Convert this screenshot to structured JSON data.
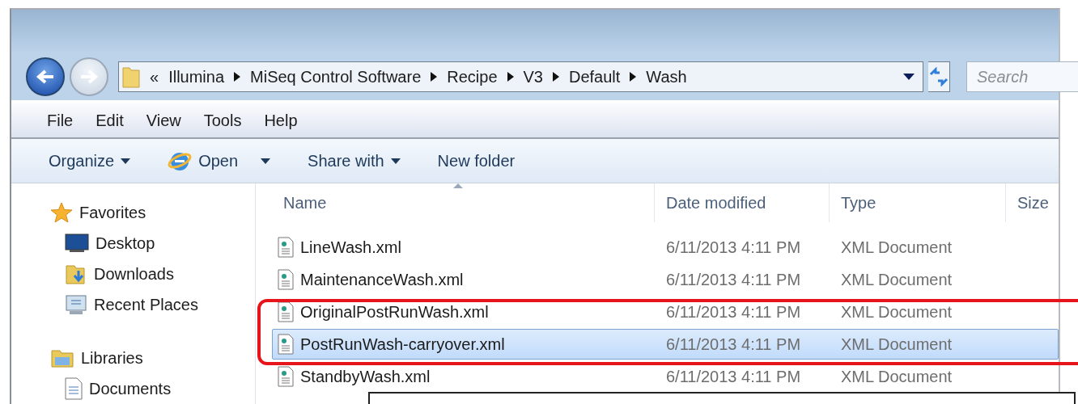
{
  "address_bar": {
    "crumbs": [
      "«",
      "Illumina",
      "MiSeq Control Software",
      "Recipe",
      "V3",
      "Default",
      "Wash"
    ]
  },
  "search": {
    "placeholder": "Search"
  },
  "menu": [
    "File",
    "Edit",
    "View",
    "Tools",
    "Help"
  ],
  "toolbar": [
    {
      "label": "Organize",
      "kind": "dropdown"
    },
    {
      "label": "Open",
      "kind": "app-dropdown"
    },
    {
      "label": "Share with",
      "kind": "dropdown"
    },
    {
      "label": "New folder",
      "kind": "button"
    }
  ],
  "sidebar": [
    {
      "label": "Favorites",
      "items": [
        "Desktop",
        "Downloads",
        "Recent Places"
      ]
    },
    {
      "label": "Libraries",
      "items": [
        "Documents"
      ]
    }
  ],
  "columns": [
    "Name",
    "Date modified",
    "Type",
    "Size"
  ],
  "rows": [
    {
      "name": "LineWash.xml",
      "date": "6/11/2013 4:11 PM",
      "type": "XML Document",
      "selected": false
    },
    {
      "name": "MaintenanceWash.xml",
      "date": "6/11/2013 4:11 PM",
      "type": "XML Document",
      "selected": false
    },
    {
      "name": "OriginalPostRunWash.xml",
      "date": "6/11/2013 4:11 PM",
      "type": "XML Document",
      "selected": false
    },
    {
      "name": "PostRunWash-carryover.xml",
      "date": "6/11/2013 4:11 PM",
      "type": "XML Document",
      "selected": true
    },
    {
      "name": "StandbyWash.xml",
      "date": "6/11/2013 4:11 PM",
      "type": "XML Document",
      "selected": false
    }
  ]
}
